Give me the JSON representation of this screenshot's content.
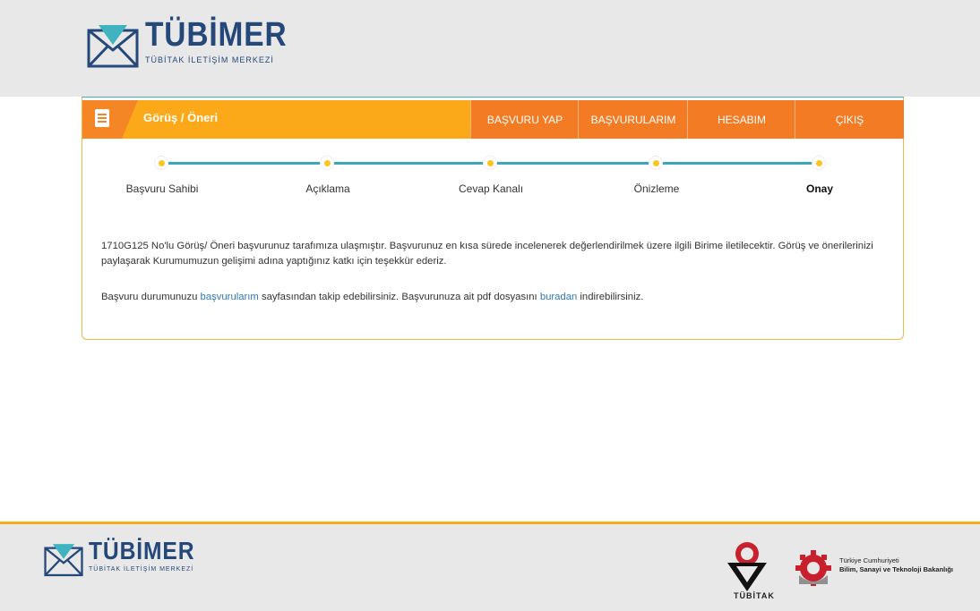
{
  "header": {
    "logo_brand": "TÜBİMER",
    "logo_tagline": "TÜBİTAK İLETİŞİM MERKEZİ"
  },
  "toolbar": {
    "page_title": "Görüş / Öneri",
    "nav": [
      {
        "label": "BAŞVURU YAP"
      },
      {
        "label": "BAŞVURULARIM"
      },
      {
        "label": "HESABIM"
      },
      {
        "label": "ÇIKIŞ"
      }
    ]
  },
  "steps": [
    {
      "label": "Başvuru Sahibi"
    },
    {
      "label": "Açıklama"
    },
    {
      "label": "Cevap Kanalı"
    },
    {
      "label": "Önizleme"
    },
    {
      "label": "Onay",
      "active": true
    }
  ],
  "message": {
    "paragraph1": "1710G125 No'lu Görüş/ Öneri başvurunuz tarafımıza ulaşmıştır. Başvurunuz en kısa sürede incelenerek değerlendirilmek üzere ilgili Birime iletilecektir. Görüş ve önerilerinizi paylaşarak Kurumumuzun gelişimi adına yaptığınız katkı için teşekkür ederiz.",
    "p2_before": "Başvuru durumunuzu ",
    "p2_link1": "başvurularım",
    "p2_middle": " sayfasından takip edebilirsiniz. Başvurunuza ait pdf dosyasını ",
    "p2_link2": "buradan",
    "p2_after": " indirebilirsiniz."
  },
  "footer": {
    "logo_brand": "TÜBİMER",
    "logo_tagline": "TÜBİTAK İLETİŞİM MERKEZİ",
    "tubitak_label": "TÜBİTAK",
    "ministry_line1": "Türkiye Cumhuriyeti",
    "ministry_line2": "Bilim, Sanayi ve Teknoloji Bakanlığı"
  },
  "colors": {
    "orange_bar": "#fba919",
    "orange_dark": "#f27b23",
    "teal": "#3aa8b8",
    "navy": "#24487a",
    "link": "#2c7ab8"
  }
}
